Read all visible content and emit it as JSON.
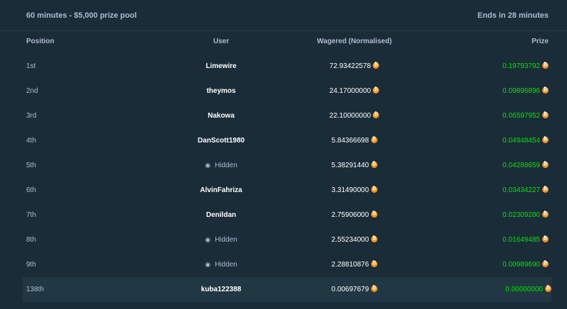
{
  "header": {
    "title": "60 minutes - $5,000 prize pool",
    "ends": "Ends in 28 minutes"
  },
  "columns": {
    "position": "Position",
    "user": "User",
    "wagered": "Wagered (Normalised)",
    "prize": "Prize"
  },
  "icons": {
    "currency": "bitcoin-icon",
    "hidden_user": "incognito-icon"
  },
  "colors": {
    "prize_green": "#00e701",
    "coin": "#f7931a"
  },
  "rows": [
    {
      "position": "1st",
      "user": "Limewire",
      "hidden": false,
      "wagered": "72.93422578",
      "prize": "0.19793792"
    },
    {
      "position": "2nd",
      "user": "theymos",
      "hidden": false,
      "wagered": "24.17000000",
      "prize": "0.09896896"
    },
    {
      "position": "3rd",
      "user": "Nakowa",
      "hidden": false,
      "wagered": "22.10000000",
      "prize": "0.06597952"
    },
    {
      "position": "4th",
      "user": "DanScott1980",
      "hidden": false,
      "wagered": "5.84366698",
      "prize": "0.04948454"
    },
    {
      "position": "5th",
      "user": "Hidden",
      "hidden": true,
      "wagered": "5.38291440",
      "prize": "0.04288659"
    },
    {
      "position": "6th",
      "user": "AlvinFahriza",
      "hidden": false,
      "wagered": "3.31490000",
      "prize": "0.03434227"
    },
    {
      "position": "7th",
      "user": "Denildan",
      "hidden": false,
      "wagered": "2.75906000",
      "prize": "0.02309280"
    },
    {
      "position": "8th",
      "user": "Hidden",
      "hidden": true,
      "wagered": "2.55234000",
      "prize": "0.01649485"
    },
    {
      "position": "9th",
      "user": "Hidden",
      "hidden": true,
      "wagered": "2.28810876",
      "prize": "0.00989690"
    },
    {
      "position": "138th",
      "user": "kuba122388",
      "hidden": false,
      "wagered": "0.00697679",
      "prize": "0.00000000",
      "current_user": true
    }
  ]
}
